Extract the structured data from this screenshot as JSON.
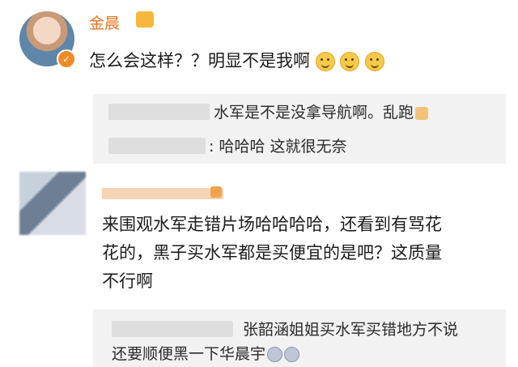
{
  "colors": {
    "username": "#e8741e",
    "text": "#1c1c1c",
    "reply_bg": "#f2f2f2",
    "verified": "#f08a24"
  },
  "post": {
    "username": "金晨",
    "content": "怎么会这样？？明显不是我啊",
    "emojis": [
      "smile-emoji",
      "smile-emoji",
      "smile-emoji"
    ],
    "replies": [
      {
        "text": "水军是不是没拿导航啊。乱跑",
        "emoji": "praying-hands-emoji"
      },
      {
        "text": ": 哈哈哈 这就很无奈"
      }
    ]
  },
  "comment": {
    "content_line1": "来围观水军走错片场哈哈哈哈，还看到有骂花",
    "content_line2": "花的，黑子买水军都是买便宜的是吧？这质量",
    "content_line3": "不行啊",
    "reply_line1": "张韶涵姐姐买水军买错地方不说",
    "reply_line2": "还要顺便黑一下华晨宇",
    "reply_emojis": [
      "laugh-cry-emoji",
      "laugh-cry-emoji"
    ]
  }
}
